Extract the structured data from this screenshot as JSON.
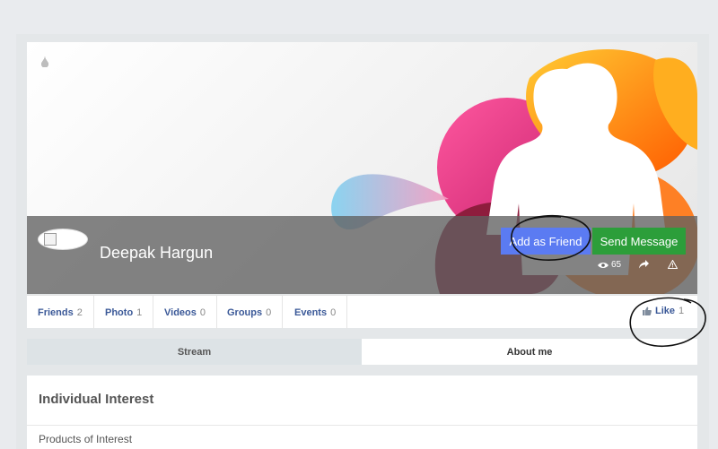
{
  "profile": {
    "name": "Deepak Hargun"
  },
  "actions": {
    "add_friend_label": "Add as Friend",
    "send_message_label": "Send Message"
  },
  "stats": {
    "views": "65"
  },
  "tabs": [
    {
      "label": "Friends",
      "count": "2"
    },
    {
      "label": "Photo",
      "count": "1"
    },
    {
      "label": "Videos",
      "count": "0"
    },
    {
      "label": "Groups",
      "count": "0"
    },
    {
      "label": "Events",
      "count": "0"
    }
  ],
  "like": {
    "label": "Like",
    "count": "1"
  },
  "subtabs": {
    "stream": "Stream",
    "about": "About me"
  },
  "panel": {
    "title": "Individual Interest",
    "subtitle": "Products of Interest"
  },
  "icons": {
    "cover_drops": "droplet-icon",
    "views": "eye-icon",
    "share": "share-arrow-icon",
    "report": "warning-triangle-icon",
    "like": "thumbs-up-icon",
    "avatar": "broken-image-icon"
  },
  "colors": {
    "add_friend_bg": "#5b7bf2",
    "send_message_bg": "#2c9e3a",
    "link": "#3b5998",
    "page_bg": "#e9ebee"
  }
}
